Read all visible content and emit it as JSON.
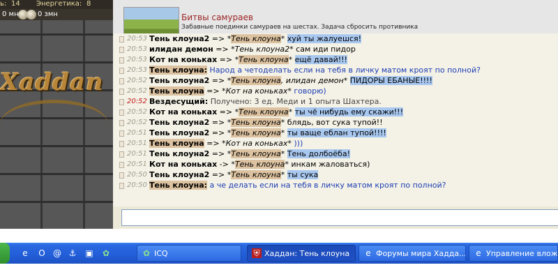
{
  "game": {
    "stats_top_value": "14",
    "stats_energy_label": "Энергетика:",
    "stats_energy_value": "8",
    "stats_left_fragment": "ь:",
    "money_mn": "0 мн",
    "money_zmn": "0 змн",
    "logo_text": "Xaddan"
  },
  "header": {
    "title": "Битвы самураев",
    "description": "Забавные поединки самураев на шестах. Задача сбросить противника"
  },
  "chat": {
    "rows": [
      {
        "time": "20:53",
        "nick": "Тень клоуна2",
        "arrow": " => *",
        "target": "Тень клоуна",
        "target_suffix": "*",
        "message": "хуй ты жалуешся!",
        "style": "hl",
        "nick_hl": false,
        "target_hl": true
      },
      {
        "time": "20:53",
        "nick": "илидан демон",
        "arrow": " => *",
        "target": "Тень клоуна2",
        "target_suffix": "*",
        "message": "сам иди пидор",
        "style": "plain",
        "nick_hl": false,
        "target_hl": false
      },
      {
        "time": "20:53",
        "nick": "Кот на коньках",
        "arrow": " => *",
        "target": "Тень клоуна",
        "target_suffix": "*",
        "message": "ещё давай!!!",
        "style": "hl",
        "nick_hl": false,
        "target_hl": true
      },
      {
        "time": "20:53",
        "nick": "Тень клоуна:",
        "arrow": "",
        "target": "",
        "target_suffix": "",
        "message": "Народ а четоделать если на тебя в личку матом кроят по полной?",
        "style": "blue",
        "nick_hl": true,
        "target_hl": false
      },
      {
        "time": "20:52",
        "nick": "Тень клоуна2",
        "arrow": " => *",
        "target": "Тень клоуна",
        "target_suffix": ", илидан демон*",
        "message": "ПИДОРЫ ЕБАНЫЕ!!!!",
        "style": "hl",
        "nick_hl": false,
        "target_hl": true
      },
      {
        "time": "20:52",
        "nick": "Тень клоуна",
        "arrow": " => *",
        "target": "Кот на коньках",
        "target_suffix": "*",
        "message": "говорю)",
        "style": "blue",
        "nick_hl": true,
        "target_hl": false
      },
      {
        "time": "20:52",
        "nick": "Вездесущий:",
        "arrow": "",
        "target": "",
        "target_suffix": "",
        "message": "Получено: 3 ед. Меди и 1 опыта Шахтера.",
        "style": "gray",
        "nick_hl": false,
        "target_hl": false,
        "red_time": true
      },
      {
        "time": "20:52",
        "nick": "Кот на коньках",
        "arrow": " => *",
        "target": "Тень клоуна",
        "target_suffix": "*",
        "message": "ты чё нибудь ему скажи!!!",
        "style": "hl",
        "nick_hl": false,
        "target_hl": true
      },
      {
        "time": "20:52",
        "nick": "Тень клоуна2",
        "arrow": " => *",
        "target": "Тень клоуна",
        "target_suffix": "*",
        "message": "блядь, вот сука тупой!!",
        "style": "plain",
        "nick_hl": false,
        "target_hl": true
      },
      {
        "time": "20:51",
        "nick": "Тень клоуна2",
        "arrow": " => *",
        "target": "Тень клоуна",
        "target_suffix": "*",
        "message": "ты ваще еблан тупой!!!!",
        "style": "hl",
        "nick_hl": false,
        "target_hl": true
      },
      {
        "time": "20:51",
        "nick": "Тень клоуна",
        "arrow": " => *",
        "target": "Кот на коньках",
        "target_suffix": "*",
        "message": ")))",
        "style": "blue",
        "nick_hl": true,
        "target_hl": false
      },
      {
        "time": "20:51",
        "nick": "Тень клоуна2",
        "arrow": " => *",
        "target": "Тень клоуна",
        "target_suffix": "*",
        "message": "Тень долбоёба!",
        "style": "hl",
        "nick_hl": false,
        "target_hl": true
      },
      {
        "time": "20:51",
        "nick": "Кот на коньках",
        "arrow": " -> *",
        "target": "Тень клоуна",
        "target_suffix": "*",
        "message": "инкам жаловаться)",
        "style": "plain",
        "nick_hl": false,
        "target_hl": true
      },
      {
        "time": "20:50",
        "nick": "Тень клоуна2",
        "arrow": " => *",
        "target": "Тень клоуна",
        "target_suffix": "*",
        "message": "ты сука",
        "style": "hl",
        "nick_hl": false,
        "target_hl": true
      },
      {
        "time": "20:50",
        "nick": "Тень клоуна:",
        "arrow": "",
        "target": "",
        "target_suffix": "",
        "message": "а че делать если на тебя в личку матом кроят по полной?",
        "style": "blue",
        "nick_hl": true,
        "target_hl": false
      }
    ]
  },
  "taskbar": {
    "tasks": [
      {
        "label": "ICQ",
        "icon": "icq-flower-icon",
        "active": false
      },
      {
        "label": "Хаддан: Тень клоуна",
        "icon": "haddan-shield-icon",
        "active": true
      },
      {
        "label": "Форумы мира Хадда...",
        "icon": "internet-explorer-icon",
        "active": false
      },
      {
        "label": "Управление вложен...",
        "icon": "internet-explorer-icon",
        "active": false
      }
    ]
  }
}
